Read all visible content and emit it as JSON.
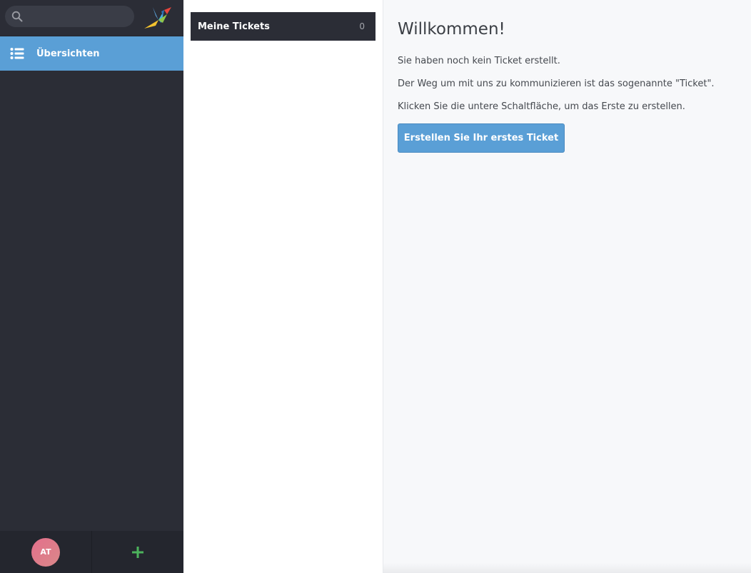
{
  "search": {
    "placeholder": "",
    "value": ""
  },
  "sidebar": {
    "items": [
      {
        "label": "Übersichten",
        "icon": "list-icon",
        "active": true
      }
    ],
    "footer": {
      "avatar_initials": "AT",
      "new_icon": "plus-icon"
    }
  },
  "overview_list": {
    "items": [
      {
        "label": "Meine Tickets",
        "count": "0"
      }
    ]
  },
  "main": {
    "headline": "Willkommen!",
    "paragraphs": [
      "Sie haben noch kein Ticket erstellt.",
      "Der Weg um mit uns zu kommunizieren ist das sogenannte \"Ticket\".",
      "Klicken Sie die untere Schaltfläche, um das Erste zu erstellen."
    ],
    "cta_label": "Erstellen Sie Ihr erstes Ticket"
  },
  "colors": {
    "sidebar_bg": "#2b2d36",
    "accent_blue": "#5a9fd6",
    "plus_green": "#4cb35c",
    "avatar": "#e46f8b",
    "main_bg": "#f7f8fa"
  }
}
